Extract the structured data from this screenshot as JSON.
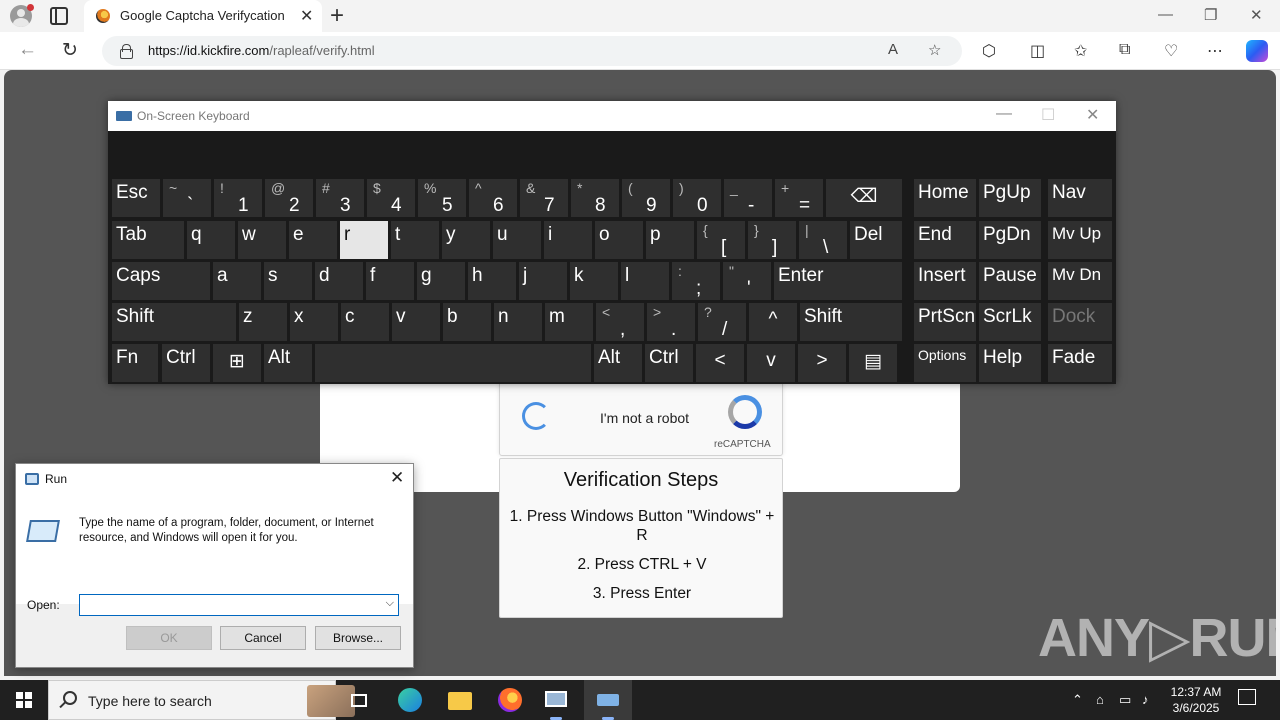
{
  "browser": {
    "tab_title": "Google Captcha Verifycation",
    "url_domain": "https://id.kickfire.com",
    "url_path": "/rapleaf/verify.html"
  },
  "captcha": {
    "checkbox_label": "I'm not a robot",
    "brand": "reCAPTCHA"
  },
  "steps": {
    "title": "Verification Steps",
    "items": [
      "1. Press Windows Button \"Windows\" + R",
      "2. Press CTRL + V",
      "3. Press Enter"
    ]
  },
  "watermark": "ANY▷RUN",
  "osk": {
    "title": "On-Screen Keyboard",
    "rows": [
      [
        {
          "m": "Esc"
        },
        {
          "s": "~",
          "m": "`"
        },
        {
          "s": "!",
          "m": "1"
        },
        {
          "s": "@",
          "m": "2"
        },
        {
          "s": "#",
          "m": "3"
        },
        {
          "s": "$",
          "m": "4"
        },
        {
          "s": "%",
          "m": "5"
        },
        {
          "s": "^",
          "m": "6"
        },
        {
          "s": "&",
          "m": "7"
        },
        {
          "s": "*",
          "m": "8"
        },
        {
          "s": "(",
          "m": "9"
        },
        {
          "s": ")",
          "m": "0"
        },
        {
          "s": "_",
          "m": "-"
        },
        {
          "s": "+",
          "m": "="
        },
        {
          "m": "⌫"
        },
        {
          "m": "Home"
        },
        {
          "m": "PgUp"
        },
        {
          "m": "Nav"
        }
      ],
      [
        {
          "m": "Tab"
        },
        {
          "m": "q"
        },
        {
          "m": "w"
        },
        {
          "m": "e"
        },
        {
          "m": "r"
        },
        {
          "m": "t"
        },
        {
          "m": "y"
        },
        {
          "m": "u"
        },
        {
          "m": "i"
        },
        {
          "m": "o"
        },
        {
          "m": "p"
        },
        {
          "s": "{",
          "m": "["
        },
        {
          "s": "}",
          "m": "]"
        },
        {
          "s": "|",
          "m": "\\"
        },
        {
          "m": "Del"
        },
        {
          "m": "End"
        },
        {
          "m": "PgDn"
        },
        {
          "m": "Mv Up"
        }
      ],
      [
        {
          "m": "Caps"
        },
        {
          "m": "a"
        },
        {
          "m": "s"
        },
        {
          "m": "d"
        },
        {
          "m": "f"
        },
        {
          "m": "g"
        },
        {
          "m": "h"
        },
        {
          "m": "j"
        },
        {
          "m": "k"
        },
        {
          "m": "l"
        },
        {
          "s": ":",
          "m": ";"
        },
        {
          "s": "\"",
          "m": "'"
        },
        {
          "m": "Enter"
        },
        {
          "m": "Insert"
        },
        {
          "m": "Pause"
        },
        {
          "m": "Mv Dn"
        }
      ],
      [
        {
          "m": "Shift"
        },
        {
          "m": "z"
        },
        {
          "m": "x"
        },
        {
          "m": "c"
        },
        {
          "m": "v"
        },
        {
          "m": "b"
        },
        {
          "m": "n"
        },
        {
          "m": "m"
        },
        {
          "s": "<",
          "m": ","
        },
        {
          "s": ">",
          "m": "."
        },
        {
          "s": "?",
          "m": "/"
        },
        {
          "m": "^"
        },
        {
          "m": "Shift"
        },
        {
          "m": "PrtScn"
        },
        {
          "m": "ScrLk"
        },
        {
          "m": "Dock"
        }
      ],
      [
        {
          "m": "Fn"
        },
        {
          "m": "Ctrl"
        },
        {
          "m": "⊞"
        },
        {
          "m": "Alt"
        },
        {
          "m": ""
        },
        {
          "m": "Alt"
        },
        {
          "m": "Ctrl"
        },
        {
          "m": "<"
        },
        {
          "m": "v"
        },
        {
          "m": ">"
        },
        {
          "m": "▤"
        },
        {
          "m": "Options"
        },
        {
          "m": "Help"
        },
        {
          "m": "Fade"
        }
      ]
    ]
  },
  "run": {
    "title": "Run",
    "description": "Type the name of a program, folder, document, or Internet resource, and Windows will open it for you.",
    "open_label": "Open:",
    "open_value": "",
    "ok": "OK",
    "cancel": "Cancel",
    "browse": "Browse..."
  },
  "taskbar": {
    "search_placeholder": "Type here to search",
    "time": "12:37 AM",
    "date": "3/6/2025"
  }
}
